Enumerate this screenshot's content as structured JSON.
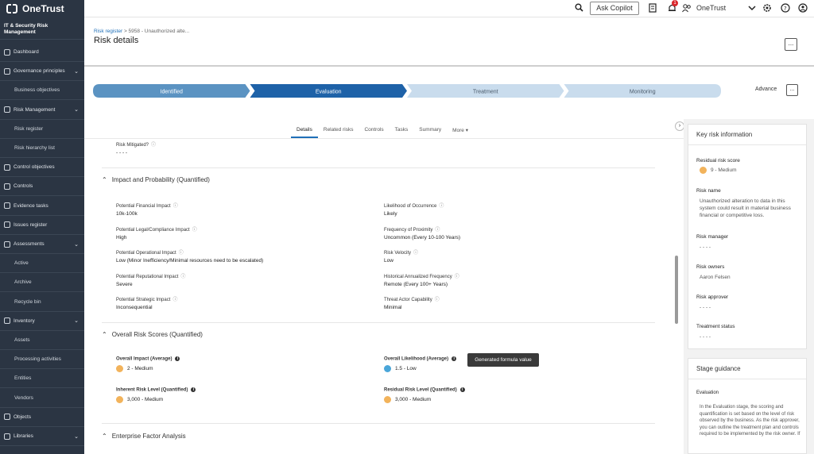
{
  "topbar": {
    "brand": "OneTrust",
    "ask_copilot": "Ask Copilot",
    "notification_count": "1",
    "org_name": "OneTrust",
    "icons": [
      "search-icon",
      "document-icon",
      "bell-icon",
      "user-switch-icon",
      "chevron-down-icon",
      "gear-icon",
      "help-icon",
      "user-icon"
    ]
  },
  "sidebar": {
    "title": "IT & Security Risk Management",
    "items": [
      {
        "label": "Dashboard",
        "type": "item"
      },
      {
        "label": "Governance principles",
        "type": "group"
      },
      {
        "label": "Business objectives",
        "type": "sub"
      },
      {
        "label": "Risk Management",
        "type": "group"
      },
      {
        "label": "Risk register",
        "type": "sub"
      },
      {
        "label": "Risk hierarchy list",
        "type": "sub"
      },
      {
        "label": "Control objectives",
        "type": "item"
      },
      {
        "label": "Controls",
        "type": "item"
      },
      {
        "label": "Evidence tasks",
        "type": "item"
      },
      {
        "label": "Issues register",
        "type": "item"
      },
      {
        "label": "Assessments",
        "type": "group"
      },
      {
        "label": "Active",
        "type": "sub"
      },
      {
        "label": "Archive",
        "type": "sub"
      },
      {
        "label": "Recycle bin",
        "type": "sub"
      },
      {
        "label": "Inventory",
        "type": "group"
      },
      {
        "label": "Assets",
        "type": "sub"
      },
      {
        "label": "Processing activities",
        "type": "sub"
      },
      {
        "label": "Entities",
        "type": "sub"
      },
      {
        "label": "Vendors",
        "type": "sub"
      },
      {
        "label": "Objects",
        "type": "item"
      },
      {
        "label": "Libraries",
        "type": "group"
      }
    ]
  },
  "header": {
    "breadcrumb_link": "Risk register",
    "breadcrumb_sep": ">",
    "breadcrumb_current": "5958 - Unauthorized alte...",
    "title": "Risk details",
    "more": "..."
  },
  "stages": {
    "items": [
      "Identified",
      "Evaluation",
      "Treatment",
      "Monitoring"
    ],
    "active": "Evaluation",
    "advance": "Advance",
    "more": "..."
  },
  "tabs": {
    "items": [
      "Details",
      "Related risks",
      "Controls",
      "Tasks",
      "Summary",
      "More ▾"
    ],
    "active": "Details",
    "collapse_arrow": "›"
  },
  "main": {
    "risk_mitigated": {
      "label": "Risk Mitigated?",
      "value": "- - - -"
    },
    "impact_section": "Impact and Probability (Quantified)",
    "impact_fields": [
      {
        "label": "Potential Financial Impact",
        "value": "10k-100k"
      },
      {
        "label": "Likelihood of Occurrence",
        "value": "Likely"
      },
      {
        "label": "Potential Legal/Compliance Impact",
        "value": "High"
      },
      {
        "label": "Frequency of Proximity",
        "value": "Uncommon (Every 10-100 Years)"
      },
      {
        "label": "Potential Operational Impact",
        "value": "Low (Minor Inefficiency/Minimal resources need to be escalated)"
      },
      {
        "label": "Risk Velocity",
        "value": "Low"
      },
      {
        "label": "Potential Reputational Impact",
        "value": "Severe"
      },
      {
        "label": "Historical Annualized Frequency",
        "value": "Remote (Every 100+ Years)"
      },
      {
        "label": "Potential Strategic Impact",
        "value": "Inconsequential"
      },
      {
        "label": "Threat Actor Capability",
        "value": "Minimal"
      }
    ],
    "scores_section": "Overall Risk Scores (Quantified)",
    "scores": [
      {
        "label": "Overall Impact (Average)",
        "value": "2 - Medium",
        "color": "#f2b35b"
      },
      {
        "label": "Overall Likelihood (Average)",
        "value": "1.5 - Low",
        "color": "#4aa6d9"
      },
      {
        "label": "Inherent Risk Level (Quantified)",
        "value": "3,000 - Medium",
        "color": "#f2b35b"
      },
      {
        "label": "Residual Risk Level (Quantified)",
        "value": "3,000 - Medium",
        "color": "#f2b35b"
      }
    ],
    "tooltip": "Generated formula value",
    "enterprise_section": "Enterprise Factor Analysis"
  },
  "right_panel": {
    "key_title": "Key risk information",
    "residual_label": "Residual risk score",
    "residual_value": "9 - Medium",
    "residual_color": "#f2b35b",
    "risk_name_label": "Risk name",
    "risk_name_value": "Unauthorized alteration to data in this system could result in material business financial or competitive loss.",
    "risk_manager_label": "Risk manager",
    "risk_manager_value": "- - - -",
    "risk_owners_label": "Risk owners",
    "risk_owners_value": "Aaron Felsen",
    "risk_approver_label": "Risk approver",
    "risk_approver_value": "- - - -",
    "treatment_label": "Treatment status",
    "treatment_value": "- - - -",
    "stage_title": "Stage guidance",
    "stage_sub": "Evaluation",
    "stage_text": "In the Evaluation stage, the scoring and quantification is set based on the level of risk observed by the business. As the risk approver, you can outline the treatment plan and controls required to be implemented by the risk owner. If"
  },
  "colors": {
    "sidebar_bg": "#2b3543",
    "stage_done": "#5b93c2",
    "stage_active": "#1e62a8",
    "stage_pending": "#c9dced",
    "accent": "#1f6fb8"
  }
}
